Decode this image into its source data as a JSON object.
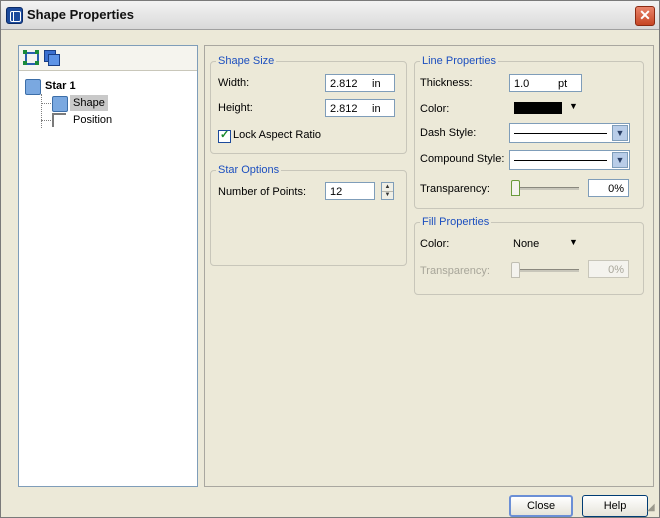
{
  "window": {
    "title": "Shape Properties"
  },
  "tree": {
    "root_label": "Star 1",
    "children": [
      "Shape",
      "Position"
    ]
  },
  "shape_size": {
    "legend": "Shape Size",
    "width_label": "Width:",
    "width_value": "2.812",
    "width_unit": "in",
    "height_label": "Height:",
    "height_value": "2.812",
    "height_unit": "in",
    "lock_label": "Lock Aspect Ratio",
    "lock_checked": true
  },
  "star_options": {
    "legend": "Star Options",
    "points_label": "Number of Points:",
    "points_value": "12"
  },
  "line_properties": {
    "legend": "Line Properties",
    "thickness_label": "Thickness:",
    "thickness_value": "1.0",
    "thickness_unit": "pt",
    "color_label": "Color:",
    "color_value": "#000000",
    "dash_label": "Dash Style:",
    "compound_label": "Compound Style:",
    "transparency_label": "Transparency:",
    "transparency_value": "0%",
    "transparency_fraction": 0
  },
  "fill_properties": {
    "legend": "Fill Properties",
    "color_label": "Color:",
    "color_value": "None",
    "transparency_label": "Transparency:",
    "transparency_value": "0%",
    "transparency_fraction": 0
  },
  "buttons": {
    "close": "Close",
    "help": "Help"
  }
}
